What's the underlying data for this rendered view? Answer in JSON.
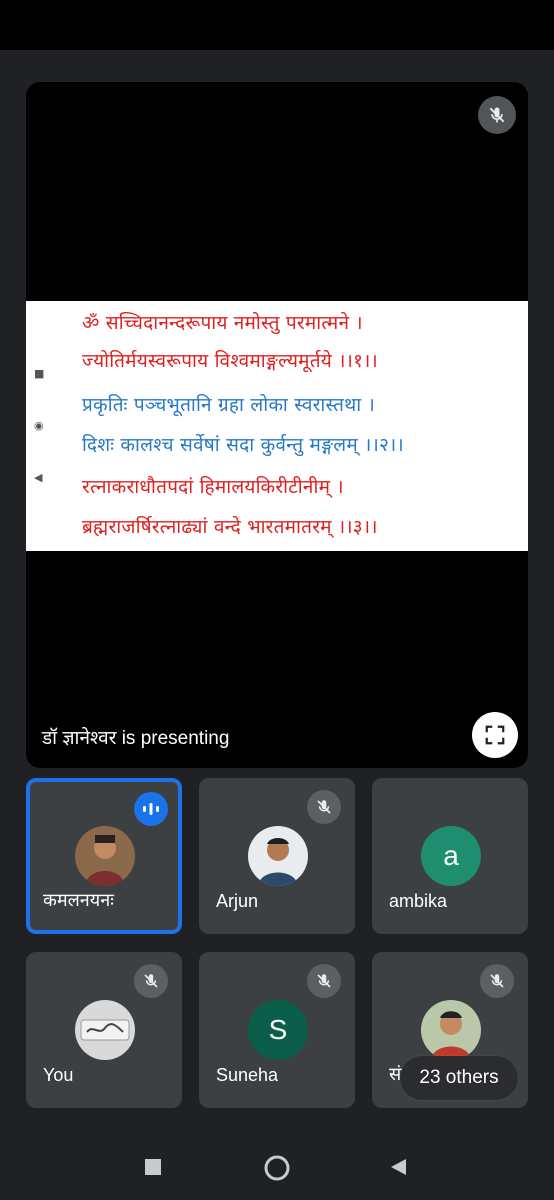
{
  "presenter": {
    "label": "डॉ ज्ञानेश्वर is presenting",
    "slide": {
      "lines": [
        "ॐ सच्चिदानन्दरूपाय नमोस्तु परमात्मने ।",
        "ज्योतिर्मयस्वरूपाय विश्वमाङ्गल्यमूर्तये ।।१।।",
        "प्रकृतिः पञ्चभूतानि ग्रहा लोका स्वरास्तथा ।",
        "दिशः कालश्च सर्वेषां सदा कुर्वन्तु मङ्गलम् ।।२।।",
        "रत्नाकराधौतपदां हिमालयकिरीटीनीम् ।",
        "ब्रह्मराजर्षिरत्नाढ्यां वन्दे भारतमातरम् ।।३।।"
      ],
      "side_glyphs": [
        "■",
        "◉",
        "◀"
      ],
      "colors": {
        "red": "#e11f1f",
        "blue": "#2878c8"
      }
    }
  },
  "participants": [
    {
      "name": "कमलनयनः",
      "avatar": "photo",
      "speaking": true,
      "muted": false
    },
    {
      "name": "Arjun",
      "avatar": "photo",
      "speaking": false,
      "muted": true
    },
    {
      "name": "ambika",
      "avatar_letter": "a",
      "avatar_color": "#1e8e6e",
      "speaking": false,
      "muted": false
    },
    {
      "name": "You",
      "avatar": "photo",
      "speaking": false,
      "muted": true
    },
    {
      "name": "Suneha",
      "avatar_letter": "S",
      "avatar_color": "#0b5e4a",
      "speaking": false,
      "muted": true
    },
    {
      "name": "संजी",
      "avatar": "photo",
      "speaking": false,
      "muted": true
    }
  ],
  "others_count_label": "23 others",
  "colors": {
    "accent": "#1a73e8",
    "tile": "#3c4043",
    "background": "#1f2124"
  },
  "icons": [
    "mic-off-icon",
    "fullscreen-icon",
    "speaking-icon",
    "nav-square-icon",
    "nav-circle-icon",
    "nav-back-icon"
  ]
}
